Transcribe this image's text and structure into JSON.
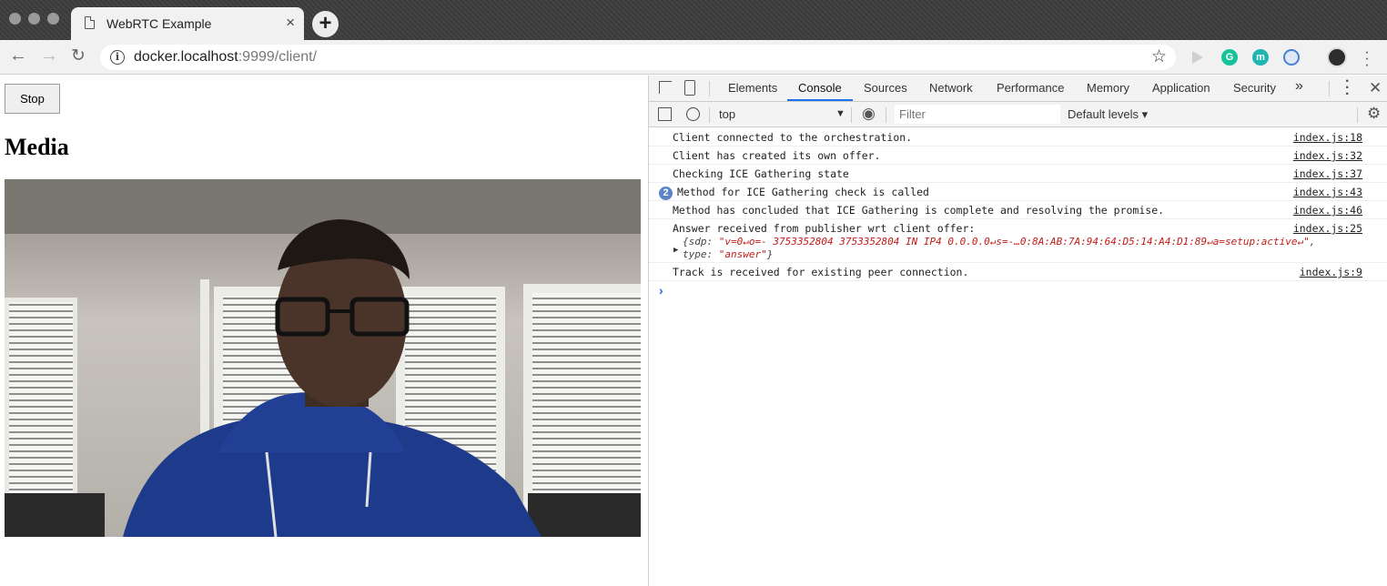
{
  "browser": {
    "tab_title": "WebRTC Example",
    "tab_close": "×",
    "new_tab": "+",
    "url_host": "docker.localhost",
    "url_rest": ":9999/client/"
  },
  "page": {
    "stop_label": "Stop",
    "heading": "Media"
  },
  "devtools": {
    "tabs": [
      "Elements",
      "Console",
      "Sources",
      "Network",
      "Performance",
      "Memory",
      "Application",
      "Security"
    ],
    "more": "»",
    "context": "top",
    "filter_placeholder": "Filter",
    "levels": "Default levels ▾",
    "logs": [
      {
        "msg": "Client connected to the orchestration.",
        "src": "index.js:18"
      },
      {
        "msg": "Client has created its own offer.",
        "src": "index.js:32"
      },
      {
        "msg": "Checking ICE Gathering state",
        "src": "index.js:37"
      },
      {
        "msg": "Method for ICE Gathering check is called",
        "src": "index.js:43",
        "count": "2"
      },
      {
        "msg": "Method has concluded that ICE Gathering is complete and resolving the promise.",
        "src": "index.js:46"
      },
      {
        "msg": "Answer received from publisher wrt client offer:",
        "src": "index.js:25",
        "obj_sdp_key": "{sdp: ",
        "obj_sdp_val": "\"v=0↵o=- 3753352804 3753352804 IN IP4 0.0.0.0↵s=-…0:8A:AB:7A:94:64:D5:14:A4:D1:89↵a=setup:active↵\"",
        "obj_sdp_tail": ",",
        "obj_type_key": "type: ",
        "obj_type_val": "\"answer\"",
        "obj_type_tail": "}"
      },
      {
        "msg": "Track is received for existing peer connection.",
        "src": "index.js:9"
      }
    ]
  }
}
